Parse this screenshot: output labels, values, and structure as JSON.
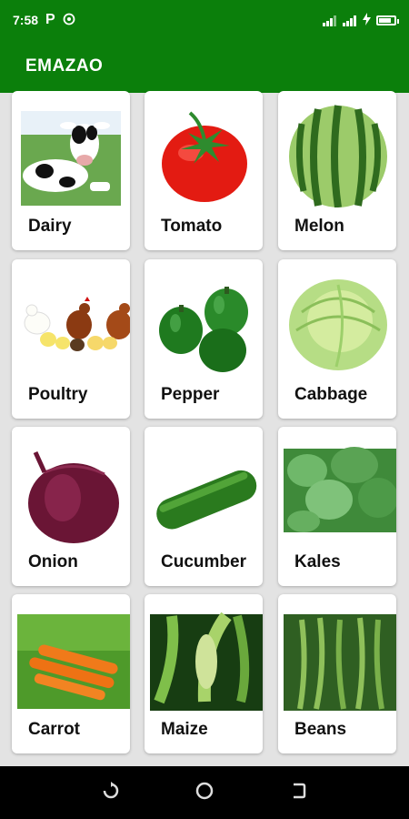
{
  "status": {
    "time": "7:58",
    "icons": [
      "parking-icon",
      "hotspot-icon",
      "signal-icon",
      "signal-icon",
      "charging-icon",
      "battery-icon"
    ],
    "battery_level": 0.9
  },
  "app": {
    "title": "EMAZAO",
    "primary_color": "#0b7f0b"
  },
  "items": [
    {
      "label": "Dairy",
      "image": "cow-image"
    },
    {
      "label": "Tomato",
      "image": "tomato-image"
    },
    {
      "label": "Melon",
      "image": "watermelon-image"
    },
    {
      "label": "Poultry",
      "image": "chickens-image"
    },
    {
      "label": "Pepper",
      "image": "green-pepper-image"
    },
    {
      "label": "Cabbage",
      "image": "cabbage-image"
    },
    {
      "label": "Onion",
      "image": "red-onion-image"
    },
    {
      "label": "Cucumber",
      "image": "cucumber-image"
    },
    {
      "label": "Kales",
      "image": "kale-image"
    },
    {
      "label": "Carrot",
      "image": "carrot-image"
    },
    {
      "label": "Maize",
      "image": "maize-image"
    },
    {
      "label": "Beans",
      "image": "green-beans-image"
    }
  ],
  "nav": {
    "icons": [
      "recents-icon",
      "home-icon",
      "back-icon"
    ]
  }
}
